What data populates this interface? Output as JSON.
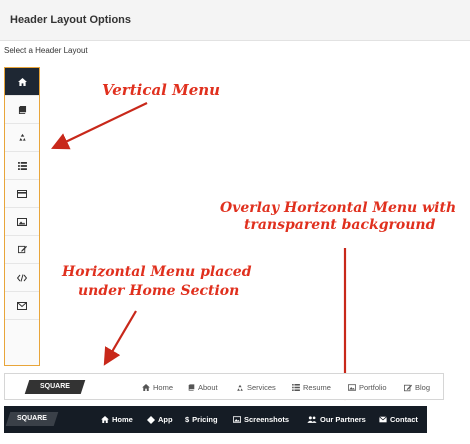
{
  "panel": {
    "title": "Header Layout Options",
    "subtitle": "Select a Header Layout"
  },
  "vertical_menu": {
    "items": [
      {
        "icon": "home-icon",
        "active": true
      },
      {
        "icon": "book-icon",
        "active": false
      },
      {
        "icon": "recycle-icon",
        "active": false
      },
      {
        "icon": "list-icon",
        "active": false
      },
      {
        "icon": "credit-card-icon",
        "active": false
      },
      {
        "icon": "image-icon",
        "active": false
      },
      {
        "icon": "edit-icon",
        "active": false
      },
      {
        "icon": "code-icon",
        "active": false
      },
      {
        "icon": "envelope-icon",
        "active": false
      }
    ]
  },
  "callouts": {
    "vertical": "Vertical Menu",
    "overlay_line1": "Overlay Horizontal Menu with",
    "overlay_line2": "transparent background",
    "under_line1": "Horizontal Menu placed",
    "under_line2": "under Home Section",
    "color": "#e0301e"
  },
  "preview_light": {
    "logo": "SQUARE",
    "nav": [
      {
        "icon": "home-icon",
        "label": "Home"
      },
      {
        "icon": "book-icon",
        "label": "About"
      },
      {
        "icon": "recycle-icon",
        "label": "Services"
      },
      {
        "icon": "list-icon",
        "label": "Resume"
      },
      {
        "icon": "image-icon",
        "label": "Portfolio"
      },
      {
        "icon": "edit-icon",
        "label": "Blog"
      }
    ]
  },
  "preview_dark": {
    "logo": "SQUARE",
    "nav": [
      {
        "icon": "home-icon",
        "label": "Home"
      },
      {
        "icon": "diamond-icon",
        "label": "App"
      },
      {
        "icon": "dollar-icon",
        "label": "Pricing"
      },
      {
        "icon": "screenshot-icon",
        "label": "Screenshots"
      },
      {
        "icon": "users-icon",
        "label": "Our Partners"
      },
      {
        "icon": "envelope-icon",
        "label": "Contact"
      }
    ]
  },
  "colors": {
    "accent_border": "#e8a53a",
    "active_bg": "#1e2733",
    "dark_bar": "#151c25"
  }
}
